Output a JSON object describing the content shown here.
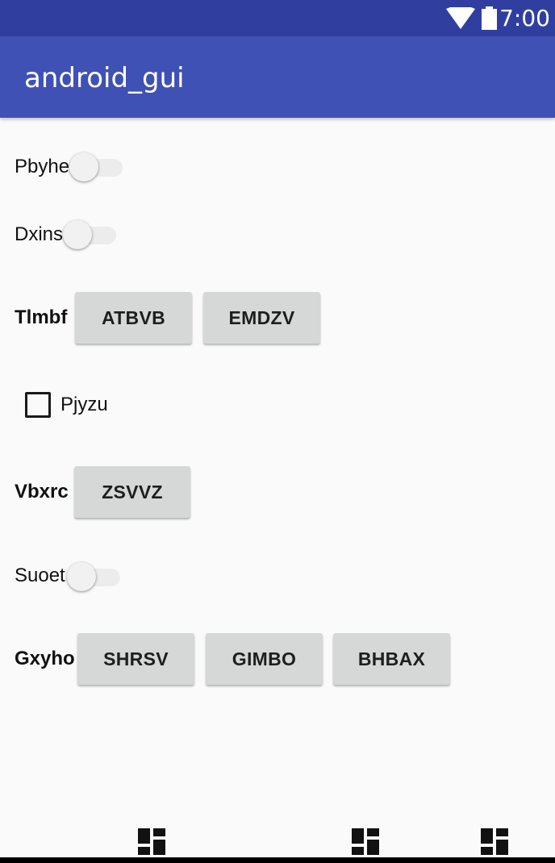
{
  "status_bar": {
    "time": "7:00"
  },
  "app_bar": {
    "title": "android_gui"
  },
  "rows": {
    "pbyhe": {
      "label": "Pbyhe",
      "switch_on": false
    },
    "dxins": {
      "label": "Dxins",
      "switch_on": false
    },
    "tlmbf": {
      "label": "Tlmbf",
      "buttons": [
        "ATBVB",
        "EMDZV"
      ]
    },
    "pjyzu": {
      "label": "Pjyzu",
      "checked": false
    },
    "vbxrc": {
      "label": "Vbxrc",
      "buttons": [
        "ZSVVZ"
      ]
    },
    "suoet": {
      "label": "Suoet",
      "switch_on": false
    },
    "gxyho": {
      "label": "Gxyho",
      "buttons": [
        "SHRSV",
        "GIMBO",
        "BHBAX"
      ]
    }
  },
  "icons": {
    "status": [
      "wifi-icon",
      "battery-icon"
    ],
    "bottom": [
      "dashboard-icon",
      "dashboard-icon",
      "dashboard-icon"
    ]
  },
  "colors": {
    "status_bar": "#303f9f",
    "app_bar": "#3f51b5",
    "background": "#fafafa",
    "button": "#d6d7d7"
  }
}
